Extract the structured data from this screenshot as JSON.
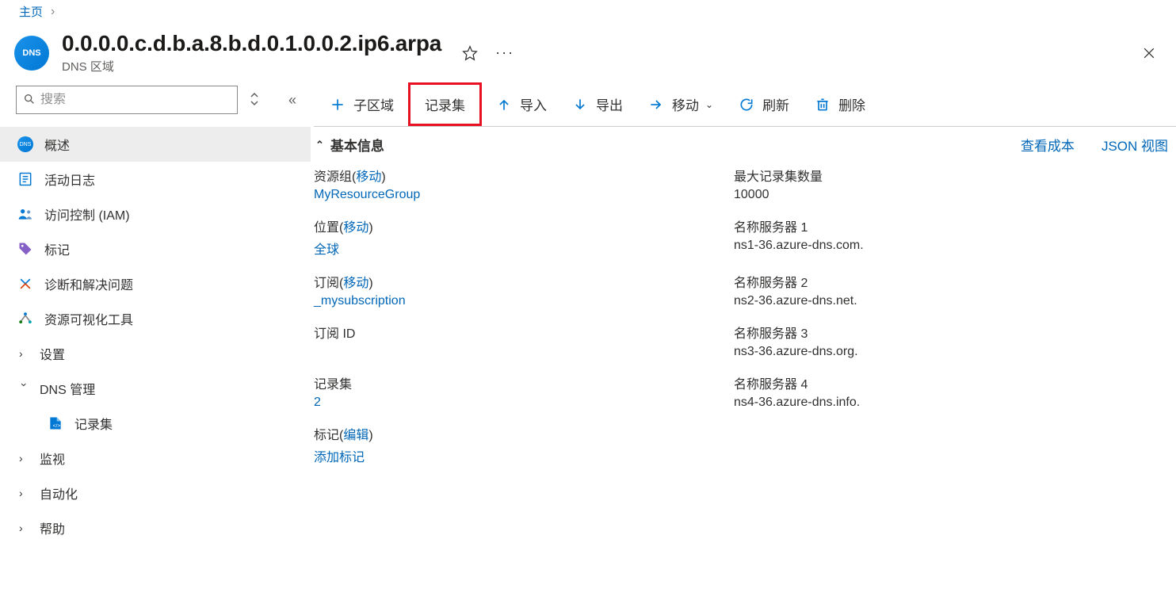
{
  "breadcrumb": {
    "home": "主页"
  },
  "header": {
    "title": "0.0.0.0.c.d.b.a.8.b.d.0.1.0.0.2.ip6.arpa",
    "subtitle": "DNS 区域",
    "icon_label": "DNS"
  },
  "search": {
    "placeholder": "搜索"
  },
  "nav": {
    "overview": "概述",
    "activity_log": "活动日志",
    "iam": "访问控制 (IAM)",
    "tags": "标记",
    "diagnose": "诊断和解决问题",
    "resource_visualizer": "资源可视化工具",
    "settings": "设置",
    "dns_management": "DNS 管理",
    "record_sets": "记录集",
    "monitoring": "监视",
    "automation": "自动化",
    "help": "帮助"
  },
  "toolbar": {
    "child_zone": "子区域",
    "record_set": "记录集",
    "import": "导入",
    "export": "导出",
    "move": "移动",
    "refresh": "刷新",
    "delete": "删除"
  },
  "essentials": {
    "label": "基本信息",
    "view_cost": "查看成本",
    "json_view": "JSON 视图",
    "resource_group_label_pre": "资源组(",
    "resource_group_move": "移动",
    "paren_close": ")",
    "resource_group_value": "MyResourceGroup",
    "location_label_pre": "位置(",
    "location_move": "移动",
    "location_value": "全球",
    "subscription_label_pre": "订阅(",
    "subscription_move": "移动",
    "subscription_value": "_mysubscription",
    "subscription_id_label": "订阅 ID",
    "subscription_id_value": "",
    "record_sets_label": "记录集",
    "record_sets_value": "2",
    "tags_label_pre": "标记(",
    "tags_edit": "编辑",
    "tags_value": "添加标记",
    "max_recordsets_label": "最大记录集数量",
    "max_recordsets_value": "10000",
    "ns1_label": "名称服务器 1",
    "ns1_value": "ns1-36.azure-dns.com.",
    "ns2_label": "名称服务器 2",
    "ns2_value": "ns2-36.azure-dns.net.",
    "ns3_label": "名称服务器 3",
    "ns3_value": "ns3-36.azure-dns.org.",
    "ns4_label": "名称服务器 4",
    "ns4_value": "ns4-36.azure-dns.info."
  }
}
